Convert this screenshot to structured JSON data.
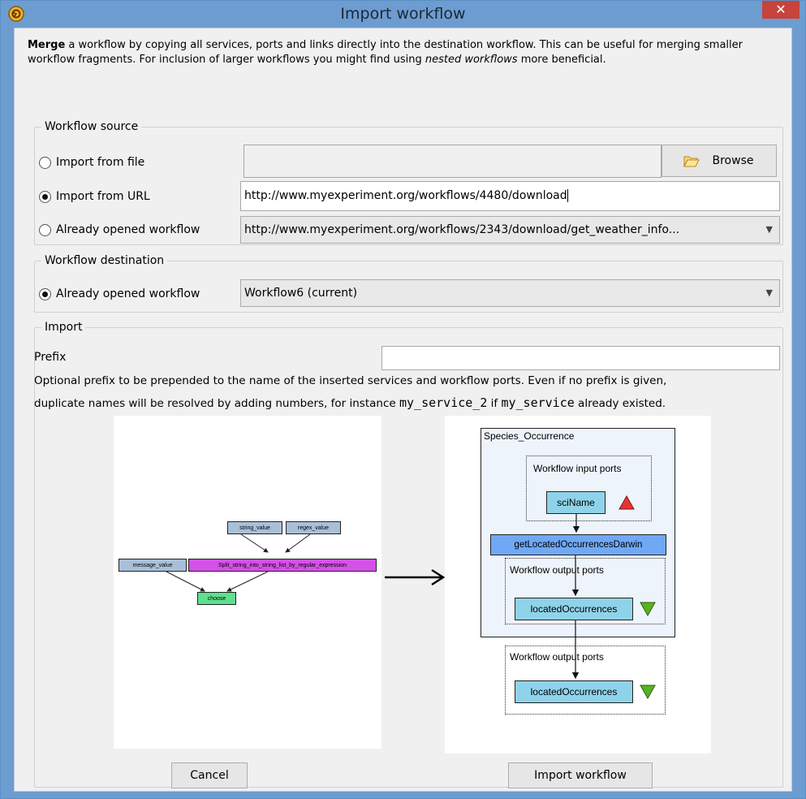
{
  "window": {
    "title": "Import workflow",
    "close": "✕"
  },
  "intro": {
    "bold": "Merge",
    "text1": " a workflow by copying all services, ports and links directly into the destination workflow. This can be useful for merging smaller workflow fragments. For inclusion of larger workflows you might find using ",
    "italic": "nested workflows",
    "text2": " more beneficial."
  },
  "source": {
    "legend": "Workflow source",
    "file_label": "Import from file",
    "file_value": "",
    "browse_label": "Browse",
    "url_label": "Import from URL",
    "url_value": "http://www.myexperiment.org/workflows/4480/download",
    "opened_label": "Already opened workflow",
    "opened_value": "http://www.myexperiment.org/workflows/2343/download/get_weather_info..."
  },
  "destination": {
    "legend": "Workflow destination",
    "opened_label": "Already opened workflow",
    "opened_value": "Workflow6 (current)"
  },
  "import": {
    "legend": "Import",
    "prefix_label": "Prefix",
    "prefix_value": "",
    "help1": "Optional prefix to be prepended to the name of the inserted services and workflow ports. Even if no prefix is given,",
    "help2a": "duplicate names will be resolved by adding numbers, for instance ",
    "help2_code1": "my_service_2",
    "help2b": " if ",
    "help2_code2": "my_service",
    "help2c": " already existed."
  },
  "left_diagram": {
    "nodes": {
      "string_value": "string_value",
      "regex_value": "regex_value",
      "message_value": "message_value",
      "split": "Split_string_into_string_list_by_regular_expression",
      "choose": "choose"
    },
    "colors": {
      "value": "#a9bfd8",
      "split": "#d451e6",
      "choose": "#5fe08e"
    }
  },
  "right_diagram": {
    "container": "Species_Occurrence",
    "input_ports": "Workflow input ports",
    "sci_name": "sciName",
    "service": "getLocatedOccurrencesDarwin",
    "output_ports_inner": "Workflow output ports",
    "located_inner": "locatedOccurrences",
    "output_ports_outer": "Workflow output ports",
    "located_outer": "locatedOccurrences",
    "colors": {
      "port": "#8fd3ea",
      "service": "#6fa8f5",
      "container_bg": "#eef4fb",
      "up": "#e8342e",
      "down": "#57b320"
    }
  },
  "buttons": {
    "cancel": "Cancel",
    "import": "Import workflow"
  }
}
